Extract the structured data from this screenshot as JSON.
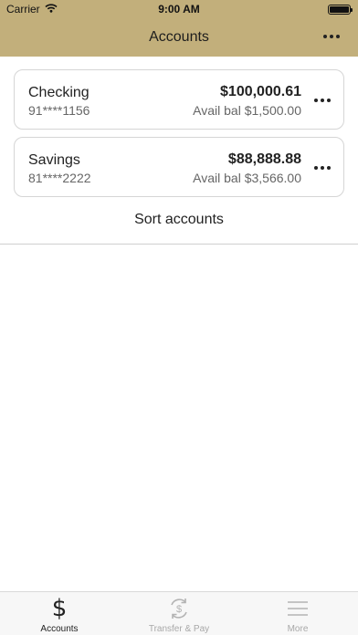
{
  "status_bar": {
    "carrier": "Carrier",
    "time": "9:00 AM",
    "icons": [
      "wifi-icon",
      "battery-icon"
    ]
  },
  "header": {
    "title": "Accounts",
    "background": "#c2af7b",
    "more_icon": "ellipsis-icon"
  },
  "accounts": [
    {
      "name": "Checking",
      "number": "91****1156",
      "balance": "$100,000.61",
      "available": "Avail bal $1,500.00"
    },
    {
      "name": "Savings",
      "number": "81****2222",
      "balance": "$88,888.88",
      "available": "Avail bal $3,566.00"
    }
  ],
  "sort_label": "Sort accounts",
  "tab_bar": {
    "active": "Accounts",
    "tabs": [
      {
        "label": "Accounts",
        "icon": "dollar-icon"
      },
      {
        "label": "Transfer & Pay",
        "icon": "transfer-icon"
      },
      {
        "label": "More",
        "icon": "menu-icon"
      }
    ]
  }
}
